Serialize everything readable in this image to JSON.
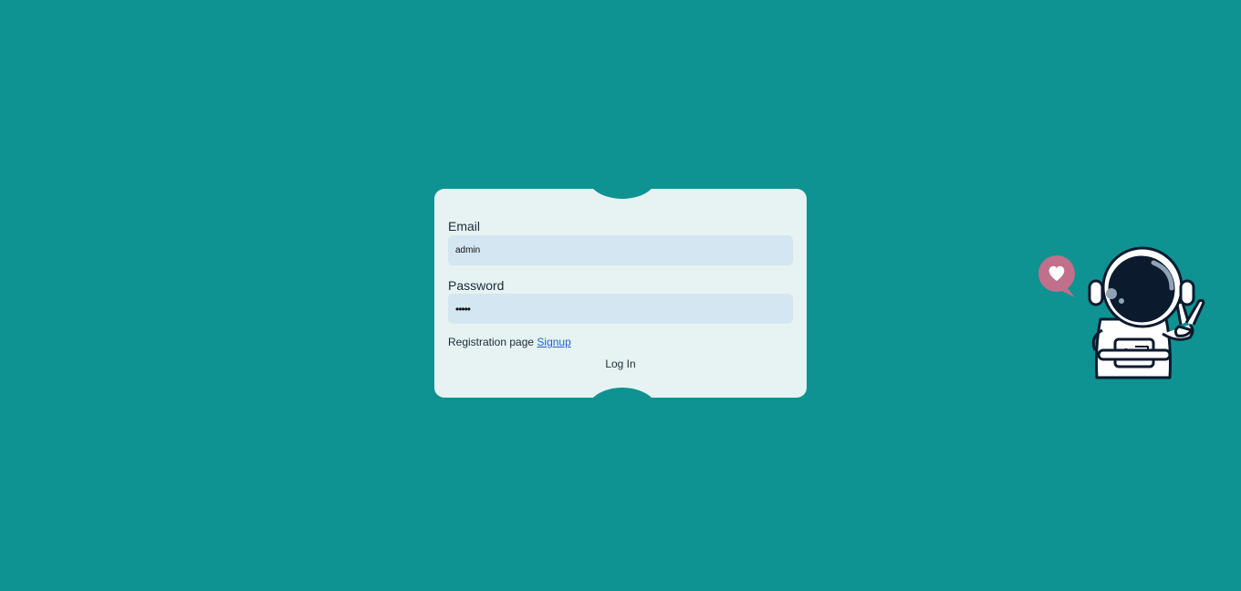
{
  "login_form": {
    "email_label": "Email",
    "email_value": "admin",
    "password_label": "Password",
    "password_value": "admin",
    "registration_text": "Registration page ",
    "signup_link": "Signup",
    "login_button": "Log In"
  },
  "illustration": {
    "icon": "astronaut-peace-sign-with-heart-bubble"
  },
  "colors": {
    "background": "#0f9292",
    "card": "#e6f3f2",
    "input": "#d4e6f1",
    "link": "#2563c9",
    "heart_bubble": "#c0708a",
    "visor": "#0c1a2e"
  }
}
